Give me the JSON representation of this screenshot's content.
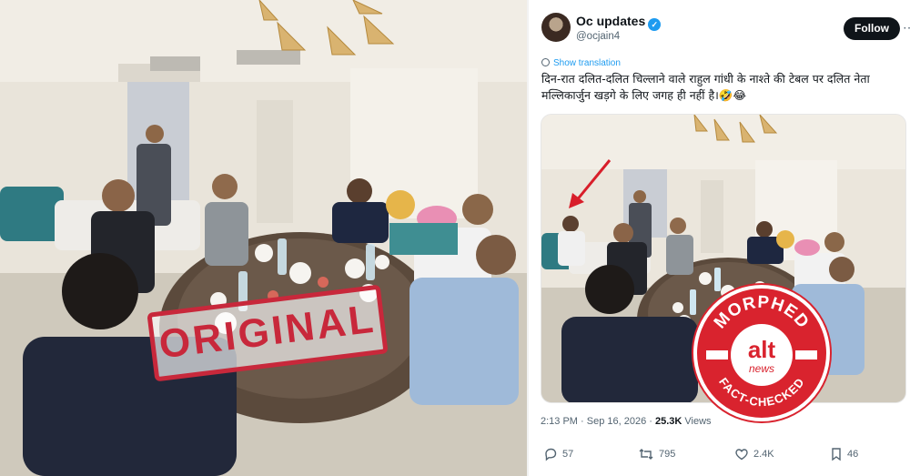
{
  "original_stamp": "ORIGINAL",
  "tweet": {
    "display_name": "Oc updates",
    "handle": "@ocjain4",
    "follow_label": "Follow",
    "show_translation": "Show translation",
    "text": "दिन-रात दलित-दलित चिल्लाने वाले राहुल गांधी के नाश्ते की टेबल पर दलित नेता मल्लिकार्जुन खड़गे के लिए जगह ही नहीं है।🤣😂",
    "timestamp": "2:13 PM · Sep 16, 2026 · ",
    "views": "25.3K",
    "views_label": "Views",
    "actions": {
      "replies": "57",
      "reposts": "795",
      "likes": "2.4K",
      "bookmarks": "46"
    }
  },
  "badge": {
    "top_text": "MORPHED",
    "logo": "alt",
    "logo_sub": "news",
    "bottom_text": "FACT-CHECKED"
  },
  "colors": {
    "stamp_red": "#c8283b",
    "badge_red": "#d9232e",
    "follow_bg": "#0f1419",
    "link_blue": "#1d9bf0",
    "arrow_red": "#d81e2a"
  },
  "icons": [
    "verified-badge-icon",
    "globe-icon",
    "reply-icon",
    "repost-icon",
    "like-icon",
    "bookmark-icon",
    "more-icon",
    "arrow-annotation-icon"
  ]
}
